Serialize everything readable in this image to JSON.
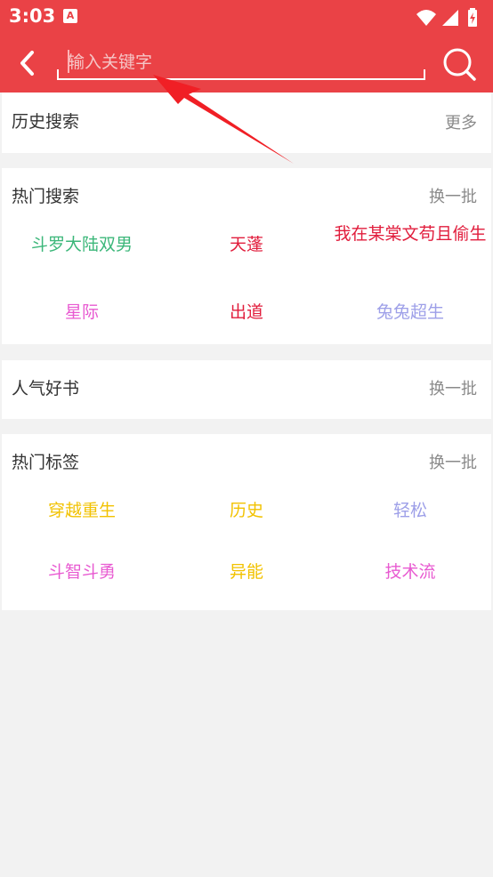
{
  "status": {
    "time": "3:03",
    "app_icon_glyph": "A"
  },
  "search": {
    "placeholder": "输入关键字",
    "value": ""
  },
  "history": {
    "title": "历史搜索",
    "action": "更多"
  },
  "hot_search": {
    "title": "热门搜索",
    "action": "换一批",
    "items": [
      {
        "text": "斗罗大陆双男",
        "color": "#3cb77a"
      },
      {
        "text": "天蓬",
        "color": "#e11d3c"
      },
      {
        "text": "我在某棠文苟且偷生",
        "color": "#e11d3c"
      },
      {
        "text": "星际",
        "color": "#e85ad1"
      },
      {
        "text": "出道",
        "color": "#e11d3c"
      },
      {
        "text": "兔兔超生",
        "color": "#9d9fe8"
      }
    ]
  },
  "popular_books": {
    "title": "人气好书",
    "action": "换一批"
  },
  "hot_tags": {
    "title": "热门标签",
    "action": "换一批",
    "items": [
      {
        "text": "穿越重生",
        "color": "#f2c200"
      },
      {
        "text": "历史",
        "color": "#f2c200"
      },
      {
        "text": "轻松",
        "color": "#9d9fe8"
      },
      {
        "text": "斗智斗勇",
        "color": "#e85ad1"
      },
      {
        "text": "异能",
        "color": "#f2c200"
      },
      {
        "text": "技术流",
        "color": "#e85ad1"
      }
    ]
  },
  "colors": {
    "brand": "#ea4246",
    "annotation_arrow": "#f01f25"
  },
  "icons": [
    "back-arrow-icon",
    "search-icon",
    "wifi-icon",
    "signal-icon",
    "battery-icon"
  ]
}
